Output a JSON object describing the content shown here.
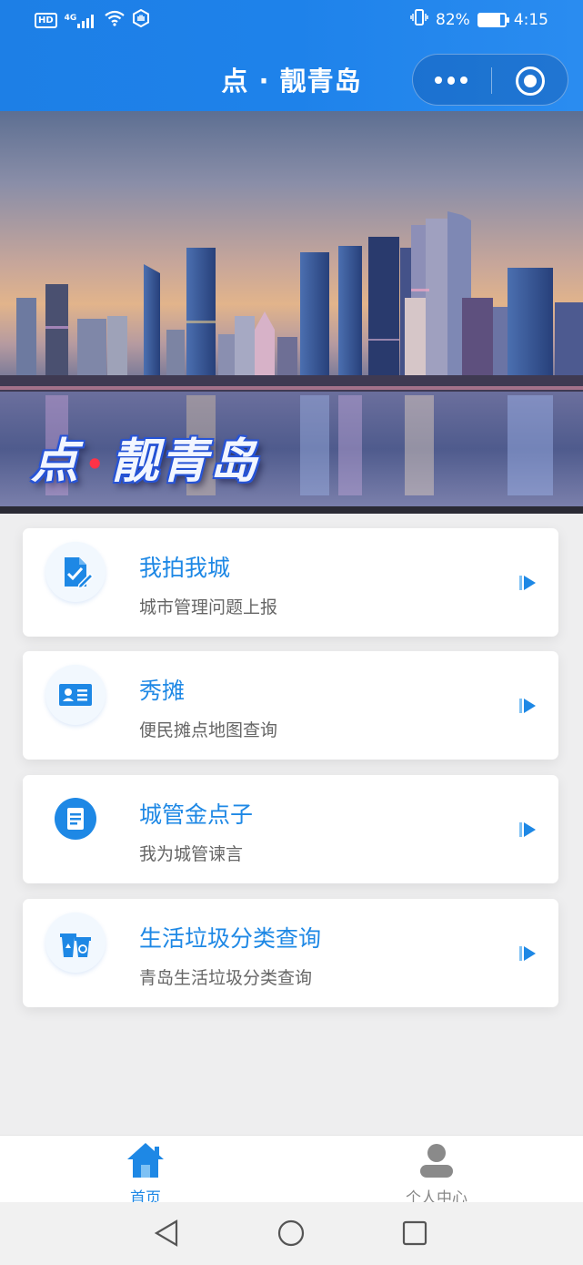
{
  "status_bar": {
    "left_badge": "HD",
    "network": "4G",
    "battery_percent": "82%",
    "battery_level": 0.82,
    "time": "4:15"
  },
  "header": {
    "title": "点 · 靓青岛"
  },
  "banner": {
    "title_left": "点",
    "title_right": "靓青岛",
    "dot": "•"
  },
  "cards": [
    {
      "title": "我拍我城",
      "subtitle": "城市管理问题上报",
      "icon": "edit-document-icon"
    },
    {
      "title": "秀摊",
      "subtitle": "便民摊点地图查询",
      "icon": "id-card-icon"
    },
    {
      "title": "城管金点子",
      "subtitle": "我为城管谏言",
      "icon": "note-icon"
    },
    {
      "title": "生活垃圾分类查询",
      "subtitle": "青岛生活垃圾分类查询",
      "icon": "recycle-bin-icon"
    }
  ],
  "tabbar": {
    "home_label": "首页",
    "me_label": "个人中心"
  },
  "colors": {
    "accent": "#1e88e5",
    "header_bg": "#1e82ea",
    "subtitle_text": "#666666"
  }
}
